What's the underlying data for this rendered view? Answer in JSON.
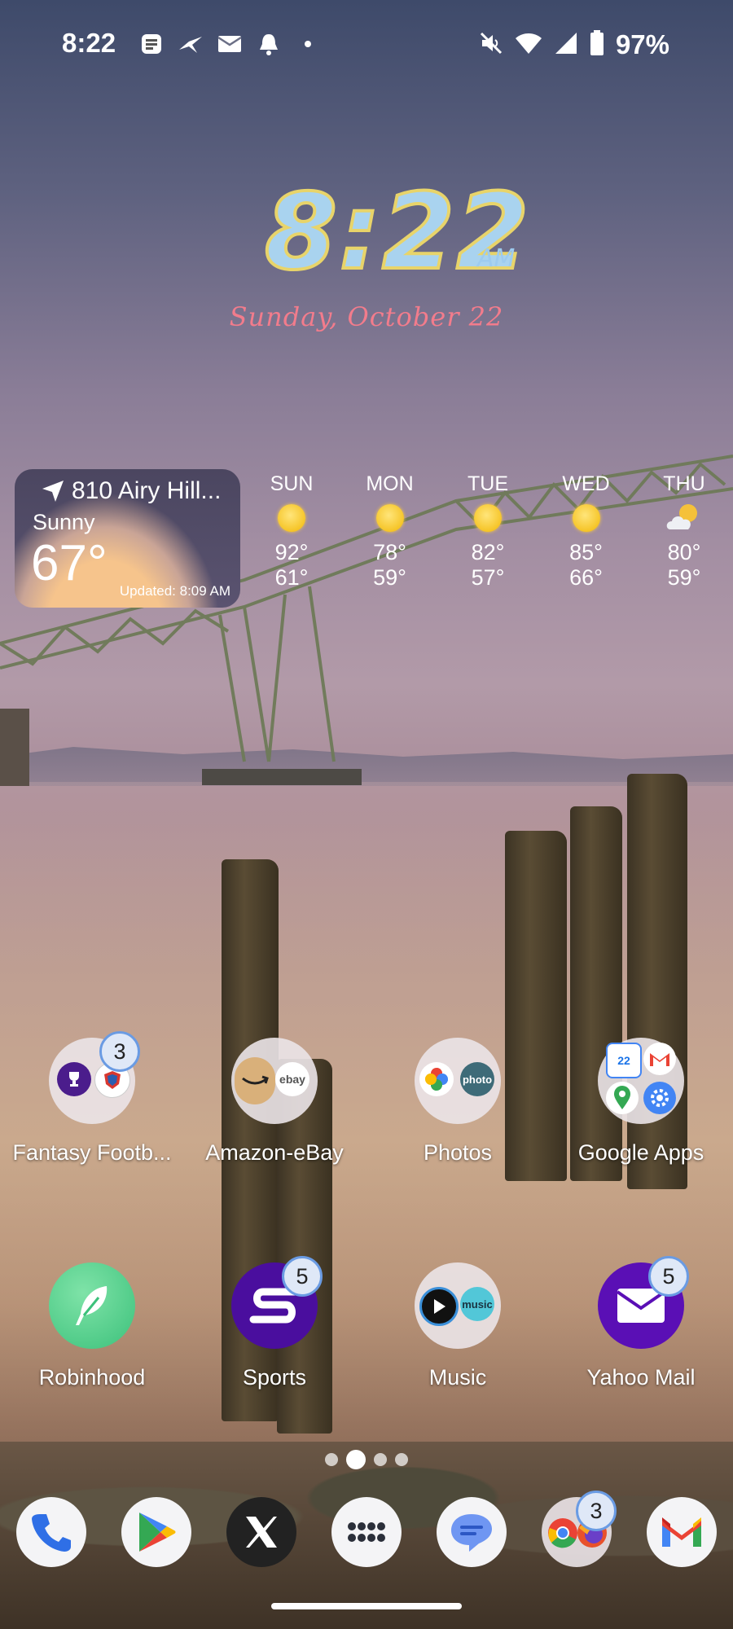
{
  "status_bar": {
    "time": "8:22",
    "notification_icons": [
      "news-icon",
      "bird-icon",
      "mail-icon",
      "bell-icon",
      "dot-icon"
    ],
    "system_icons": [
      "mute-icon",
      "wifi-icon",
      "signal-icon",
      "battery-icon"
    ],
    "battery": "97%"
  },
  "clock": {
    "time": "8:22",
    "ampm": "AM",
    "date": "Sunday, October 22",
    "colors": {
      "digits": "#a9d3ef",
      "outline": "#e8d46a",
      "date": "#f27c8c"
    }
  },
  "weather": {
    "location": "810 Airy Hill...",
    "condition": "Sunny",
    "temperature": "67°",
    "updated": "Updated: 8:09 AM",
    "forecast": [
      {
        "day": "SUN",
        "icon": "sun-icon",
        "high": "92°",
        "low": "61°"
      },
      {
        "day": "MON",
        "icon": "sun-icon",
        "high": "78°",
        "low": "59°"
      },
      {
        "day": "TUE",
        "icon": "sun-icon",
        "high": "82°",
        "low": "57°"
      },
      {
        "day": "WED",
        "icon": "sun-icon",
        "high": "85°",
        "low": "66°"
      },
      {
        "day": "THU",
        "icon": "partly-cloudy-icon",
        "high": "80°",
        "low": "59°"
      }
    ]
  },
  "apps": {
    "row1": [
      {
        "label": "Fantasy Footb...",
        "type": "folder",
        "badge": "3"
      },
      {
        "label": "Amazon-eBay",
        "type": "folder",
        "mini_labels": [
          "ebay"
        ]
      },
      {
        "label": "Photos",
        "type": "folder",
        "mini_labels": [
          "photo"
        ]
      },
      {
        "label": "Google Apps",
        "type": "folder",
        "mini_labels": [
          "22"
        ]
      }
    ],
    "row2": [
      {
        "label": "Robinhood",
        "icon": "feather-icon"
      },
      {
        "label": "Sports",
        "icon": "sports-s-icon",
        "badge": "5"
      },
      {
        "label": "Music",
        "type": "folder",
        "mini_labels": [
          "music"
        ]
      },
      {
        "label": "Yahoo Mail",
        "icon": "envelope-icon",
        "badge": "5"
      }
    ]
  },
  "pager": {
    "pages": 4,
    "active": 2
  },
  "dock": [
    {
      "name": "phone-icon"
    },
    {
      "name": "play-store-icon"
    },
    {
      "name": "x-icon"
    },
    {
      "name": "app-drawer-icon"
    },
    {
      "name": "messages-icon"
    },
    {
      "name": "browser-folder-icon",
      "badge": "3"
    },
    {
      "name": "gmail-icon"
    }
  ]
}
